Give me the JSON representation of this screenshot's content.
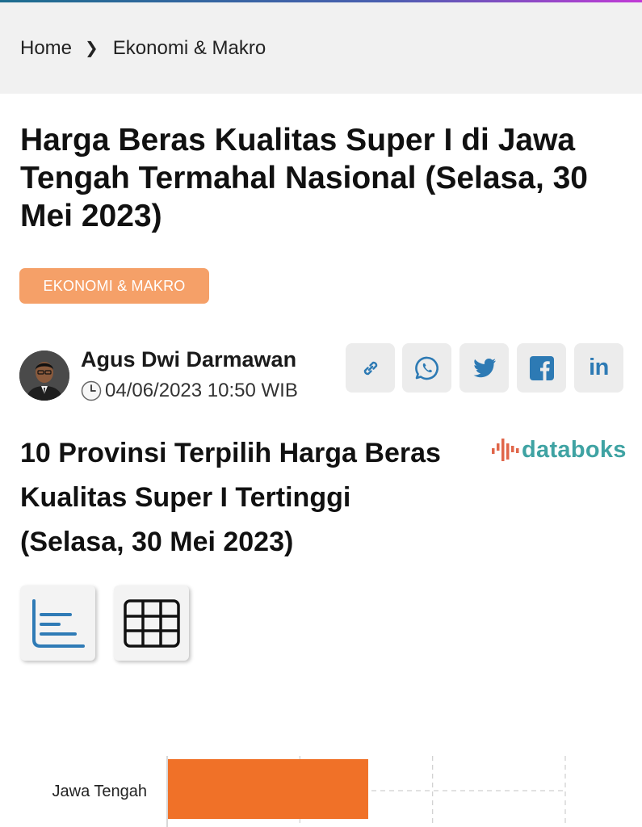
{
  "breadcrumb": {
    "home": "Home",
    "separator": "❯",
    "current": "Ekonomi & Makro"
  },
  "article": {
    "title": "Harga Beras Kualitas Super I di Jawa Tengah Termahal Nasional (Selasa, 30 Mei 2023)",
    "category": "EKONOMI & MAKRO",
    "author": "Agus Dwi Darmawan",
    "date": "04/06/2023 10:50 WIB"
  },
  "share": [
    "link-icon",
    "whatsapp-icon",
    "twitter-icon",
    "facebook-icon",
    "linkedin-icon"
  ],
  "share_labels": {
    "linkedin": "in"
  },
  "chart_section": {
    "title_line1": "10 Provinsi Terpilih Harga Beras",
    "title_line2": "Kualitas Super I Tertinggi",
    "title_line3": "(Selasa, 30 Mei 2023)",
    "brand": "databoks",
    "view_buttons": [
      "bar-chart-view-icon",
      "table-view-icon"
    ]
  },
  "colors": {
    "accent": "#f07128",
    "category_bg": "#f5a068",
    "brand": "#3fa3a3",
    "icon_blue": "#2d7ab4"
  },
  "chart_data": {
    "type": "bar",
    "orientation": "horizontal",
    "categories": [
      "Jawa Tengah"
    ],
    "series": [
      {
        "values": [
          15150
        ]
      }
    ],
    "xlim": [
      0,
      30000
    ],
    "grid": true
  }
}
